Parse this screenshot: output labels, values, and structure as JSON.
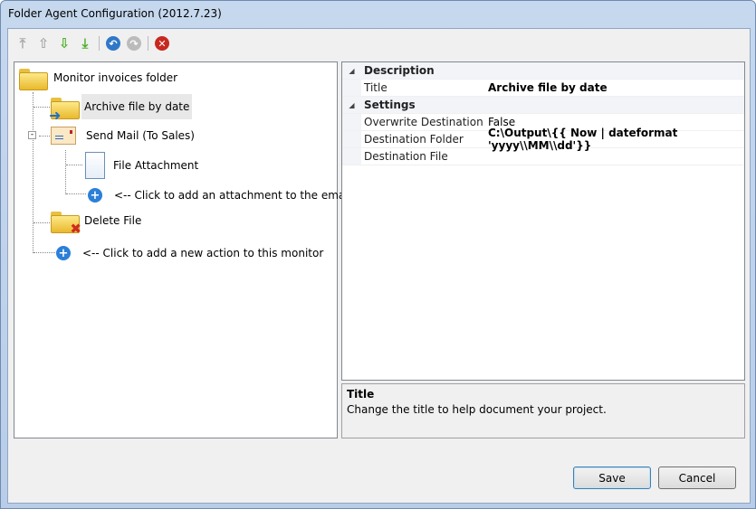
{
  "window": {
    "title": "Folder Agent Configuration (2012.7.23)"
  },
  "toolbar": [
    "move-to-top-icon",
    "move-up-icon",
    "move-down-icon",
    "move-to-bottom-icon",
    "undo-icon",
    "redo-icon",
    "delete-icon"
  ],
  "tree": {
    "root": "Monitor invoices folder",
    "archive": "Archive file by date",
    "send_mail": "Send Mail (To Sales)",
    "attachment": "File Attachment",
    "add_attachment": "<-- Click to add an attachment to the email",
    "delete": "Delete File",
    "add_action": "<-- Click to add a new action to this monitor"
  },
  "properties": {
    "description": {
      "label": "Description",
      "title_name": "Title",
      "title_value": "Archive file by date"
    },
    "settings": {
      "label": "Settings",
      "overwrite_name": "Overwrite Destination",
      "overwrite_value": "False",
      "folder_name": "Destination Folder",
      "folder_value": "C:\\Output\\{{ Now | dateformat 'yyyy\\\\MM\\\\dd'}}",
      "file_name": "Destination File",
      "file_value": ""
    }
  },
  "help": {
    "title": "Title",
    "text": "Change the title to help document your project."
  },
  "buttons": {
    "save": "Save",
    "cancel": "Cancel"
  }
}
